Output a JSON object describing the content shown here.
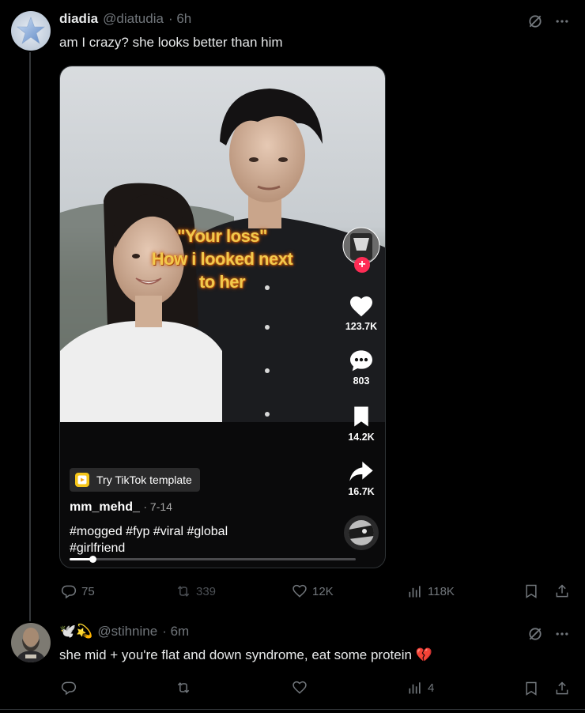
{
  "tweet1": {
    "display_name": "diadia",
    "handle": "@diatudia",
    "time": "· 6h",
    "text": "am I crazy? she looks better than him",
    "video": {
      "caption_line1": "\"Your loss\"",
      "caption_line2": "How i looked next",
      "caption_line3": "to her",
      "likes": "123.7K",
      "comments": "803",
      "saves": "14.2K",
      "shares": "16.7K",
      "template_label": "Try TikTok template",
      "username": "mm_mehd_",
      "date": "· 7-14",
      "tags_line1": "#mogged #fyp #viral #global",
      "tags_line2": "#girlfriend",
      "progress": 0.08
    },
    "actions": {
      "replies": "75",
      "reposts": "339",
      "likes": "12K",
      "views": "118K"
    }
  },
  "tweet2": {
    "emoji": "🕊️💫",
    "handle": "@stihnine",
    "time": "· 6m",
    "text": "she mid + you're flat and down syndrome, eat some protein 💔",
    "actions": {
      "views": "4"
    }
  },
  "colors": {
    "muted": "#71767b",
    "text": "#e7e9ea",
    "background": "#000000",
    "tiktok_red": "#fe2c55"
  }
}
